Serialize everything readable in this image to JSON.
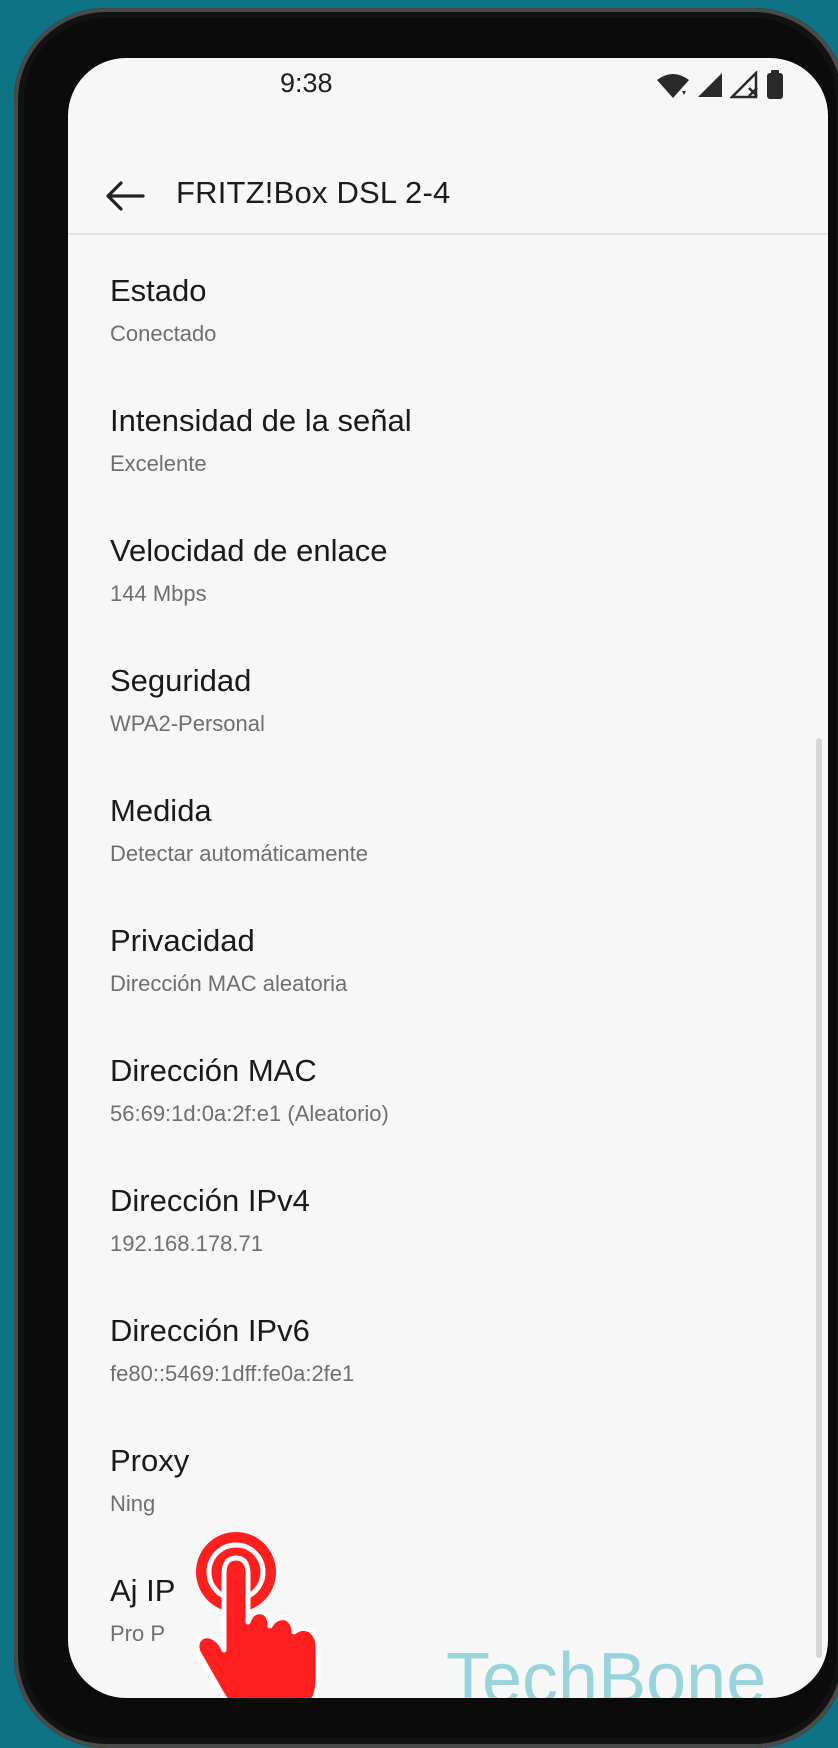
{
  "status_bar": {
    "time": "9:38",
    "icons": [
      "wifi-icon",
      "cell-signal-icon",
      "cell-signal-x-icon",
      "battery-icon"
    ]
  },
  "app_bar": {
    "title": "FRITZ!Box DSL 2-4",
    "back_icon": "arrow-left-icon"
  },
  "details": [
    {
      "title": "Estado",
      "value": "Conectado"
    },
    {
      "title": "Intensidad de la señal",
      "value": "Excelente"
    },
    {
      "title": "Velocidad de enlace",
      "value": "144 Mbps"
    },
    {
      "title": "Seguridad",
      "value": "WPA2-Personal"
    },
    {
      "title": "Medida",
      "value": "Detectar automáticamente"
    },
    {
      "title": "Privacidad",
      "value": "Dirección MAC aleatoria"
    },
    {
      "title": "Dirección MAC",
      "value": "56:69:1d:0a:2f:e1 (Aleatorio)"
    },
    {
      "title": "Dirección IPv4",
      "value": "192.168.178.71"
    },
    {
      "title": "Dirección IPv6",
      "value": "fe80::5469:1dff:fe0a:2fe1"
    },
    {
      "title": "Proxy",
      "value": "Ning"
    },
    {
      "title": "Aj IP",
      "value": "Pro P"
    }
  ],
  "overlay": {
    "watermark": "TechBone",
    "tap_indicator_icon": "tap-hand-icon",
    "tap_color": "#ff1f1f"
  }
}
